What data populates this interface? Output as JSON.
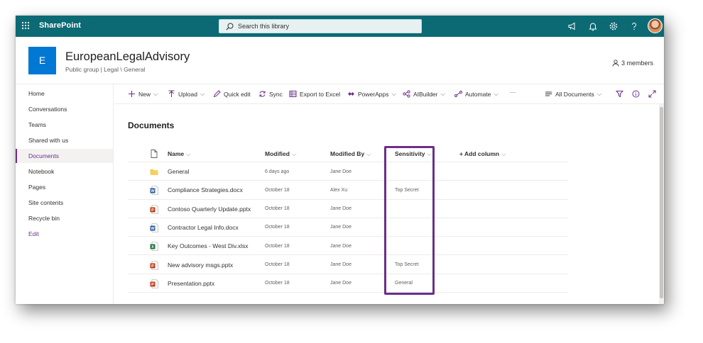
{
  "suite": {
    "app_name": "SharePoint",
    "search_placeholder": "Search this library",
    "icons": [
      "waffle-icon",
      "megaphone-icon",
      "bell-icon",
      "gear-icon",
      "help-icon"
    ],
    "colors": {
      "bar": "#0b6a74",
      "accent": "#6b2f8a"
    }
  },
  "site": {
    "logo_letter": "E",
    "logo_color": "#0078d4",
    "title": "EuropeanLegalAdvisory",
    "subtitle": "Public group | Legal \\ General",
    "members": "3 members"
  },
  "nav": {
    "items": [
      {
        "label": "Home"
      },
      {
        "label": "Conversations"
      },
      {
        "label": "Teams"
      },
      {
        "label": "Shared with us"
      },
      {
        "label": "Documents",
        "active": true
      },
      {
        "label": "Notebook"
      },
      {
        "label": "Pages"
      },
      {
        "label": "Site contents"
      },
      {
        "label": "Recycle bin"
      },
      {
        "label": "Edit"
      }
    ]
  },
  "commands": {
    "new": "New",
    "upload": "Upload",
    "quick_edit": "Quick edit",
    "sync": "Sync",
    "export": "Export to Excel",
    "powerapps": "PowerApps",
    "aibuilder": "AIBuilder",
    "automate": "Automate",
    "more": "···",
    "view": "All Documents"
  },
  "library": {
    "title": "Documents",
    "columns": {
      "name": "Name",
      "modified": "Modified",
      "modified_by": "Modified By",
      "sensitivity": "Sensitivity",
      "add_column": "+ Add column"
    },
    "rows": [
      {
        "type": "folder",
        "name": "General",
        "modified": "6 days ago",
        "modified_by": "Jane Doe",
        "sensitivity": ""
      },
      {
        "type": "docx",
        "name": "Compliance Strategies.docx",
        "modified": "October 18",
        "modified_by": "Alex Xu",
        "sensitivity": "Top Secret"
      },
      {
        "type": "pptx",
        "name": "Contoso Quarterly Update.pptx",
        "modified": "October 18",
        "modified_by": "Jane Doe",
        "sensitivity": ""
      },
      {
        "type": "docx",
        "name": "Contractor Legal Info.docx",
        "modified": "October 18",
        "modified_by": "Jane Doe",
        "sensitivity": ""
      },
      {
        "type": "xlsx",
        "name": "Key Outcomes - West Div.xlsx",
        "modified": "October 18",
        "modified_by": "Jane Doe",
        "sensitivity": ""
      },
      {
        "type": "pptx",
        "name": "New advisory msgs.pptx",
        "modified": "October 18",
        "modified_by": "Jane Doe",
        "sensitivity": "Top Secret"
      },
      {
        "type": "pptx",
        "name": "Presentation.pptx",
        "modified": "October 18",
        "modified_by": "Jane Doe",
        "sensitivity": "General"
      }
    ]
  }
}
